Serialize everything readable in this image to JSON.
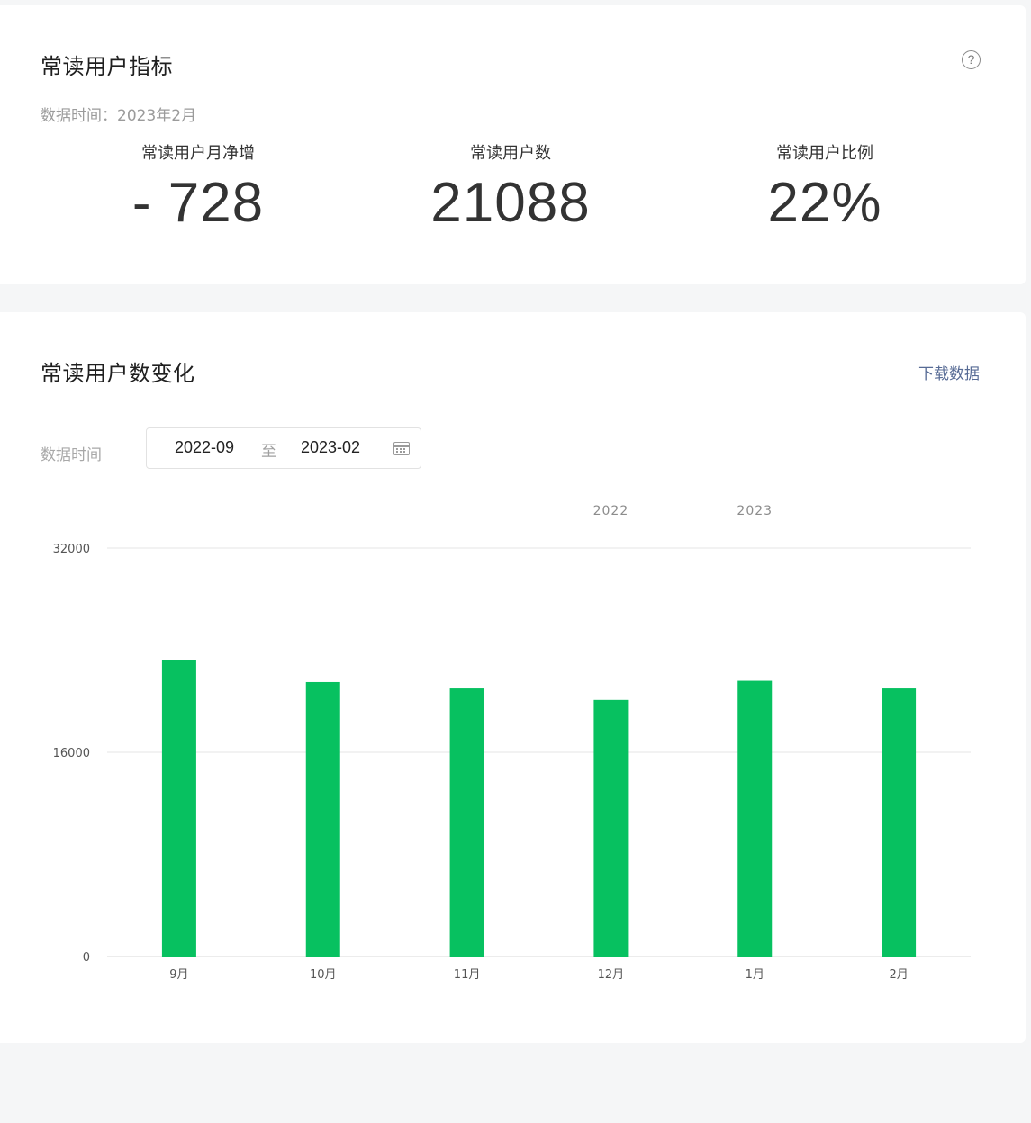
{
  "metrics_card": {
    "title": "常读用户指标",
    "help_icon": "question-circle-icon",
    "data_time": "数据时间：2023年2月",
    "items": [
      {
        "label": "常读用户月净增",
        "value": "- 728"
      },
      {
        "label": "常读用户数",
        "value": "21088"
      },
      {
        "label": "常读用户比例",
        "value": "22%"
      }
    ]
  },
  "trend_card": {
    "title": "常读用户数变化",
    "download_label": "下载数据",
    "filter_label": "数据时间",
    "range": {
      "start": "2022-09",
      "separator": "至",
      "end": "2023-02",
      "icon": "calendar-icon"
    }
  },
  "colors": {
    "bar": "#07c160",
    "link": "#576b95",
    "grid": "#e5e5e5"
  },
  "chart_data": {
    "type": "bar",
    "categories": [
      "9月",
      "10月",
      "11月",
      "12月",
      "1月",
      "2月"
    ],
    "year_labels": [
      {
        "label": "2022",
        "category": "12月"
      },
      {
        "label": "2023",
        "category": "1月"
      }
    ],
    "series": [
      {
        "values": [
          23200,
          21500,
          21000,
          20100,
          21600,
          21000
        ]
      }
    ],
    "yticks": [
      0,
      16000,
      32000
    ],
    "ylim": [
      0,
      32000
    ],
    "grid": true,
    "legend": "none"
  }
}
